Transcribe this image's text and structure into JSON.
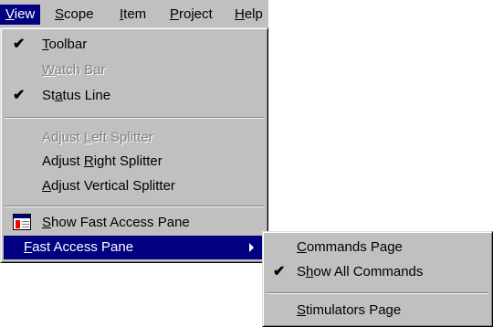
{
  "menubar": [
    {
      "pre": "",
      "u": "V",
      "post": "iew",
      "active": true
    },
    {
      "pre": "",
      "u": "S",
      "post": "cope"
    },
    {
      "pre": "",
      "u": "I",
      "post": "tem"
    },
    {
      "pre": "",
      "u": "P",
      "post": "roject"
    },
    {
      "pre": "",
      "u": "H",
      "post": "elp"
    }
  ],
  "view_menu": {
    "toolbar": {
      "pre": "",
      "u": "T",
      "post": "oolbar",
      "checked": true
    },
    "watch_bar": {
      "pre": "",
      "u": "W",
      "post": "atch Bar",
      "disabled": true
    },
    "status_line": {
      "pre": "St",
      "u": "a",
      "post": "tus Line",
      "checked": true
    },
    "adjust_left": {
      "pre": "Adjust ",
      "u": "L",
      "post": "eft Splitter",
      "disabled": true
    },
    "adjust_right": {
      "pre": "Adjust ",
      "u": "R",
      "post": "ight Splitter"
    },
    "adjust_vertical": {
      "pre": "",
      "u": "A",
      "post": "djust Vertical Splitter"
    },
    "show_fast": {
      "pre": "",
      "u": "S",
      "post": "how Fast Access Pane",
      "icon": "access-pane-icon"
    },
    "fast_access": {
      "pre": "",
      "u": "F",
      "post": "ast Access Pane",
      "submenu": true
    }
  },
  "fast_access_submenu": {
    "commands_page": {
      "pre": "",
      "u": "C",
      "post": "ommands Page"
    },
    "show_all": {
      "pre": "S",
      "u": "h",
      "post": "ow All Commands",
      "checked": true
    },
    "stimulators_page": {
      "pre": "",
      "u": "S",
      "post": "timulators Page"
    }
  },
  "check_glyph": "✔"
}
